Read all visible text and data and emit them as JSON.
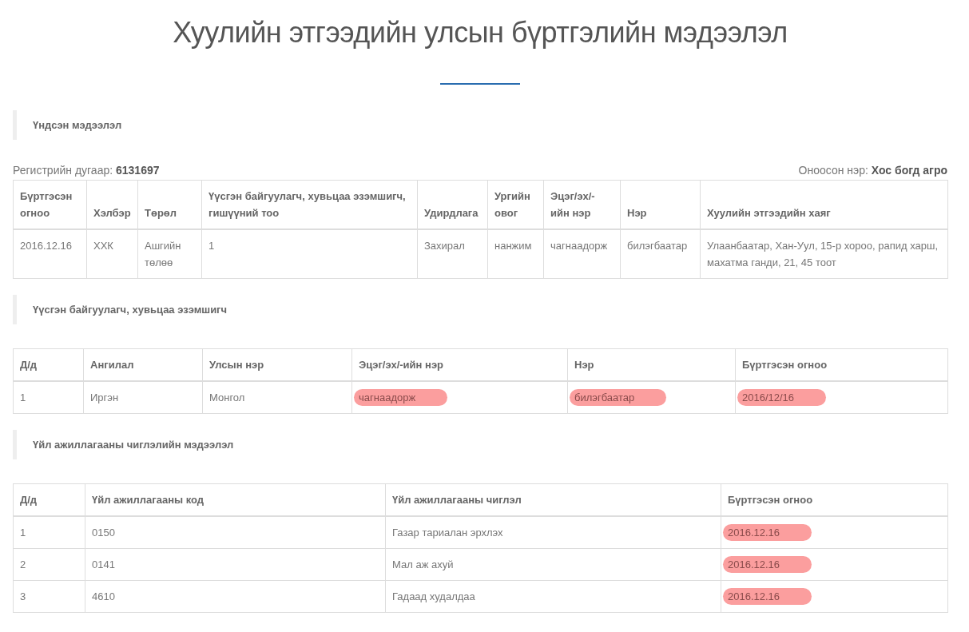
{
  "title": "Хуулийн этгээдийн улсын бүртгэлийн мэдээлэл",
  "basic": {
    "heading": "Үндсэн мэдээлэл",
    "register": {
      "label": "Регистрийн дугаар:",
      "value": "6131697"
    },
    "name": {
      "label": "Оноосон нэр:",
      "value": "Хос богд агро"
    },
    "columns": [
      "Бүртгэсэн огноо",
      "Хэлбэр",
      "Төрөл",
      "Үүсгэн байгуулагч, хувьцаа эзэмшигч, гишүүний тоо",
      "Удирдлага",
      "Ургийн овог",
      "Эцэг/эх/-ийн нэр",
      "Нэр",
      "Хуулийн этгээдийн хаяг"
    ],
    "rows": [
      [
        "2016.12.16",
        "ХХК",
        "Ашгийн төлөө",
        "1",
        "Захирал",
        "нанжим",
        "чагнаадорж",
        "билэгбаатар",
        "Улаанбаатар, Хан-Уул, 15-р хороо, рапид харш, махатма ганди, 21, 45 тоот"
      ]
    ]
  },
  "founders": {
    "heading": "Үүсгэн байгуулагч, хувьцаа эзэмшигч",
    "columns": [
      "Д/д",
      "Ангилал",
      "Улсын нэр",
      "Эцэг/эх/-ийн нэр",
      "Нэр",
      "Бүртгэсэн огноо"
    ],
    "rows": [
      [
        {
          "text": "1",
          "highlighted": false
        },
        {
          "text": "Иргэн",
          "highlighted": false
        },
        {
          "text": "Монгол",
          "highlighted": false
        },
        {
          "text": "чагнаадорж",
          "highlighted": true
        },
        {
          "text": "билэгбаатар",
          "highlighted": true
        },
        {
          "text": "2016/12/16",
          "highlighted": true
        }
      ]
    ]
  },
  "activities": {
    "heading": "Үйл ажиллагааны чиглэлийн мэдээлэл",
    "columns": [
      "Д/д",
      "Үйл ажиллагааны код",
      "Үйл ажиллагааны чиглэл",
      "Бүртгэсэн огноо"
    ],
    "rows": [
      [
        {
          "text": "1",
          "highlighted": false
        },
        {
          "text": "0150",
          "highlighted": false
        },
        {
          "text": "Газар тариалан эрхлэх",
          "highlighted": false
        },
        {
          "text": "2016.12.16",
          "highlighted": true
        }
      ],
      [
        {
          "text": "2",
          "highlighted": false
        },
        {
          "text": "0141",
          "highlighted": false
        },
        {
          "text": "Мал аж ахуй",
          "highlighted": false
        },
        {
          "text": "2016.12.16",
          "highlighted": true
        }
      ],
      [
        {
          "text": "3",
          "highlighted": false
        },
        {
          "text": "4610",
          "highlighted": false
        },
        {
          "text": "Гадаад худалдаа",
          "highlighted": false
        },
        {
          "text": "2016.12.16",
          "highlighted": true
        }
      ]
    ]
  }
}
